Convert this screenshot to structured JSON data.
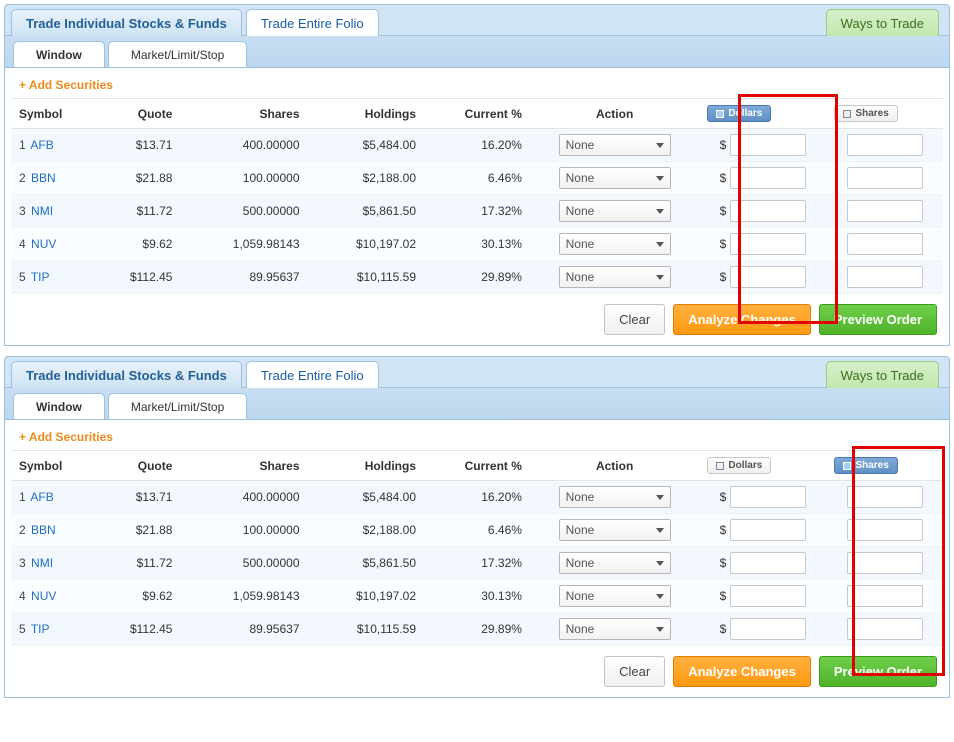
{
  "common": {
    "top_tabs": {
      "individual": "Trade Individual Stocks & Funds",
      "folio": "Trade Entire Folio",
      "ways": "Ways to Trade"
    },
    "sub_tabs": {
      "window": "Window",
      "mls": "Market/Limit/Stop"
    },
    "add_securities": "+ Add Securities",
    "headers": {
      "symbol": "Symbol",
      "quote": "Quote",
      "shares": "Shares",
      "holdings": "Holdings",
      "current": "Current %",
      "action": "Action",
      "dollars_btn": "Dollars",
      "shares_btn": "Shares"
    },
    "rows": [
      {
        "idx": "1",
        "sym": "AFB",
        "quote": "$13.71",
        "shares": "400.00000",
        "holdings": "$5,484.00",
        "current": "16.20%",
        "action": "None"
      },
      {
        "idx": "2",
        "sym": "BBN",
        "quote": "$21.88",
        "shares": "100.00000",
        "holdings": "$2,188.00",
        "current": "6.46%",
        "action": "None"
      },
      {
        "idx": "3",
        "sym": "NMI",
        "quote": "$11.72",
        "shares": "500.00000",
        "holdings": "$5,861.50",
        "current": "17.32%",
        "action": "None"
      },
      {
        "idx": "4",
        "sym": "NUV",
        "quote": "$9.62",
        "shares": "1,059.98143",
        "holdings": "$10,197.02",
        "current": "30.13%",
        "action": "None"
      },
      {
        "idx": "5",
        "sym": "TIP",
        "quote": "$112.45",
        "shares": "89.95637",
        "holdings": "$10,115.59",
        "current": "29.89%",
        "action": "None"
      }
    ],
    "dollar_sign": "$",
    "buttons": {
      "clear": "Clear",
      "analyze": "Analyze Changes",
      "preview": "Preview Order"
    }
  }
}
